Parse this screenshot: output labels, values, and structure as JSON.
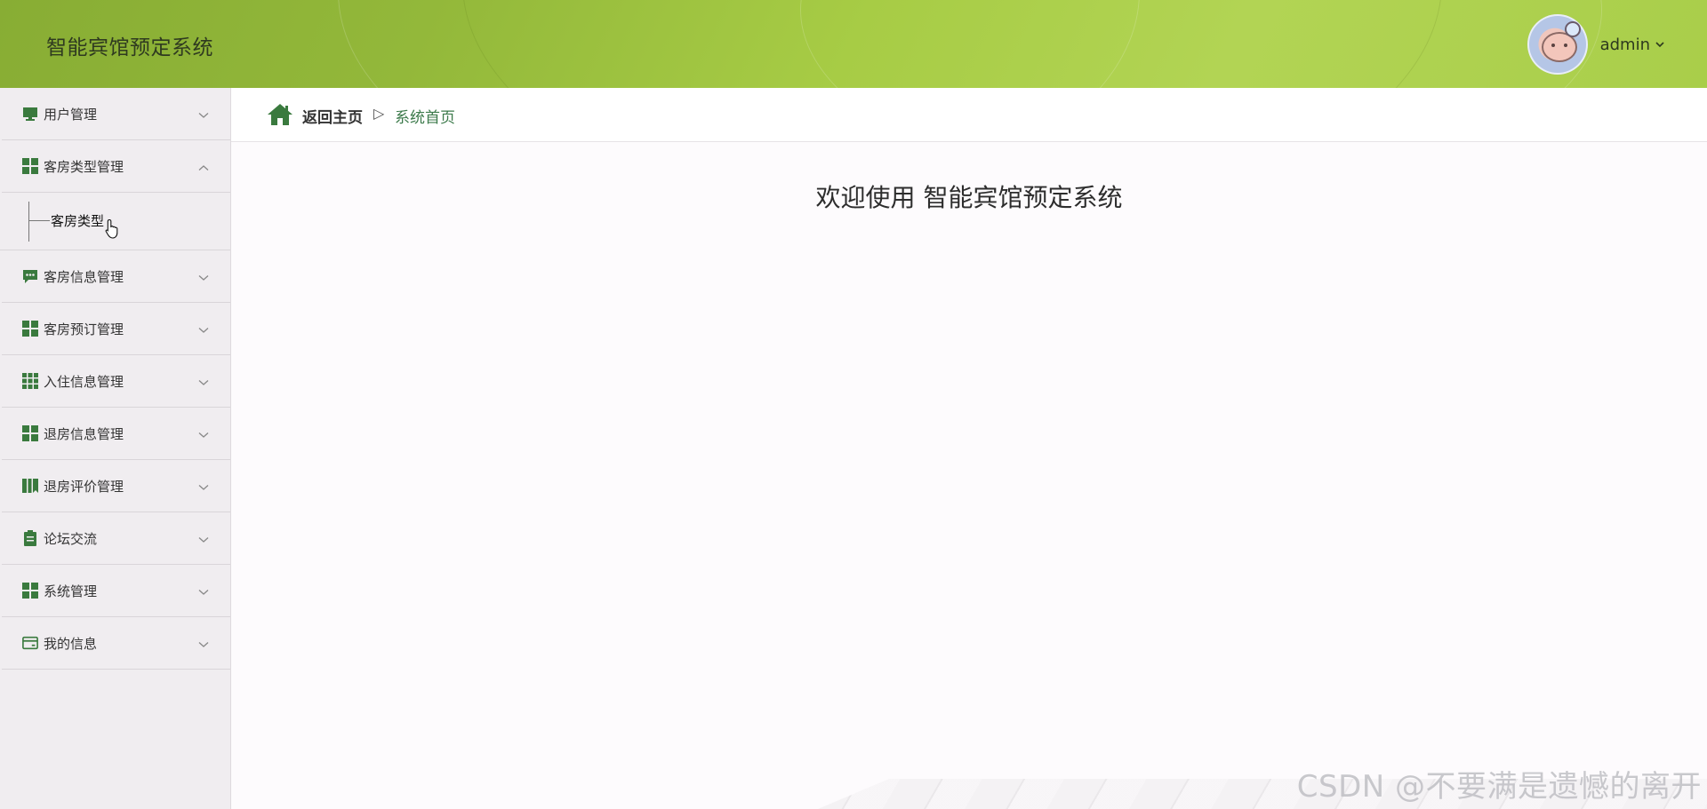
{
  "header": {
    "app_title": "智能宾馆预定系统",
    "user": {
      "name": "admin",
      "avatar_icon": "avatar-bear-icon",
      "caret": "⌄"
    },
    "colors": {
      "gradient_start": "#88ad34",
      "gradient_end": "#b2d454"
    }
  },
  "sidebar": {
    "accent_icon_color": "#3a7a3e",
    "items": [
      {
        "label": "用户管理",
        "icon": "monitor-icon",
        "expanded": false
      },
      {
        "label": "客房类型管理",
        "icon": "grid-icon",
        "expanded": true,
        "children": [
          {
            "label": "客房类型"
          }
        ]
      },
      {
        "label": "客房信息管理",
        "icon": "chat-icon",
        "expanded": false
      },
      {
        "label": "客房预订管理",
        "icon": "grid-icon",
        "expanded": false
      },
      {
        "label": "入住信息管理",
        "icon": "grid-nine-icon",
        "expanded": false
      },
      {
        "label": "退房信息管理",
        "icon": "grid-icon",
        "expanded": false
      },
      {
        "label": "退房评价管理",
        "icon": "book-icon",
        "expanded": false
      },
      {
        "label": "论坛交流",
        "icon": "clipboard-icon",
        "expanded": false
      },
      {
        "label": "系统管理",
        "icon": "grid-icon",
        "expanded": false
      },
      {
        "label": "我的信息",
        "icon": "card-icon",
        "expanded": false
      }
    ]
  },
  "breadcrumb": {
    "home_label": "返回主页",
    "separator": "▷",
    "current": "系统首页"
  },
  "main": {
    "welcome_text": "欢迎使用 智能宾馆预定系统"
  },
  "watermark": "CSDN @不要满是遗憾的离开"
}
